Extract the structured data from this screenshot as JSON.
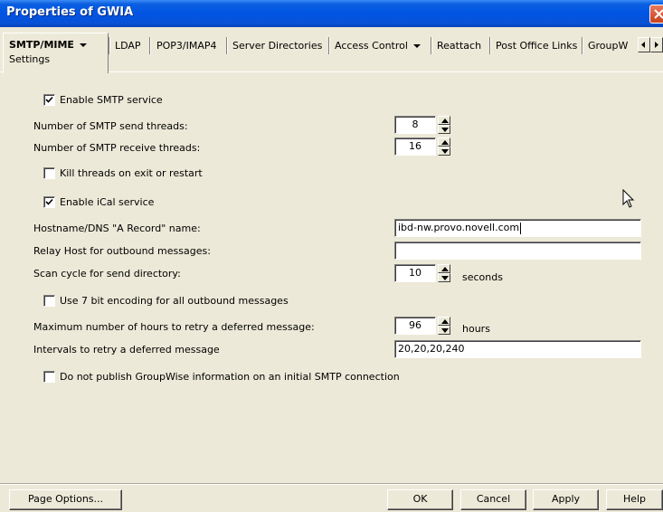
{
  "window": {
    "title": "Properties of GWIA"
  },
  "tabs": {
    "active": {
      "label": "SMTP/MIME",
      "sublabel": "Settings"
    },
    "others": [
      "LDAP",
      "POP3/IMAP4",
      "Server Directories",
      "Access Control",
      "Reattach",
      "Post Office Links",
      "GroupW"
    ]
  },
  "form": {
    "enable_smtp": {
      "label": "Enable SMTP service",
      "checked": true
    },
    "send_threads": {
      "label": "Number of SMTP send threads:",
      "value": "8"
    },
    "receive_threads": {
      "label": "Number of SMTP receive threads:",
      "value": "16"
    },
    "kill_threads": {
      "label": "Kill threads on exit or restart",
      "checked": false
    },
    "enable_ical": {
      "label": "Enable iCal service",
      "checked": true
    },
    "hostname": {
      "label": "Hostname/DNS \"A Record\" name:",
      "value": "ibd-nw.provo.novell.com"
    },
    "relay_host": {
      "label": "Relay Host for outbound messages:",
      "value": ""
    },
    "scan_cycle": {
      "label": "Scan cycle for send directory:",
      "value": "10",
      "unit": "seconds"
    },
    "seven_bit": {
      "label": "Use 7 bit encoding for all outbound messages",
      "checked": false
    },
    "max_retry_hours": {
      "label": "Maximum number of hours to retry a deferred message:",
      "value": "96",
      "unit": "hours"
    },
    "retry_intervals": {
      "label": "Intervals to retry a deferred message",
      "value": "20,20,20,240"
    },
    "no_publish": {
      "label": "Do not publish GroupWise information on an initial SMTP connection",
      "checked": false
    }
  },
  "buttons": {
    "page_options": "Page Options...",
    "ok": "OK",
    "cancel": "Cancel",
    "apply": "Apply",
    "help": "Help"
  },
  "icons": [
    "close-icon",
    "dropdown-caret-icon",
    "scroll-left-icon",
    "scroll-right-icon",
    "checkmark-icon",
    "spin-up-icon",
    "spin-down-icon",
    "mouse-pointer-icon"
  ]
}
